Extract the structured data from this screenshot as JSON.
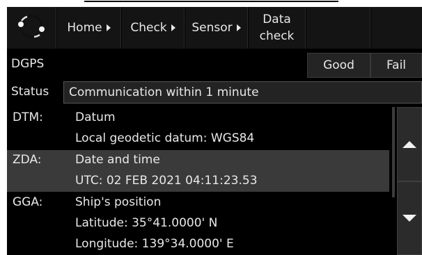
{
  "nav": {
    "home": "Home",
    "check": "Check",
    "sensor": "Sensor",
    "data_check_line1": "Data",
    "data_check_line2": "check"
  },
  "dgps": {
    "label": "DGPS",
    "good": "Good",
    "fail": "Fail"
  },
  "status": {
    "label": "Status",
    "value": "Communication within 1 minute"
  },
  "sentences": [
    {
      "code": "DTM:",
      "lines": [
        "Datum",
        "Local geodetic datum: WGS84"
      ]
    },
    {
      "code": "ZDA:",
      "lines": [
        "Date and time",
        "UTC: 02 FEB 2021 04:11:23.53"
      ]
    },
    {
      "code": "GGA:",
      "lines": [
        "Ship's position",
        "Latitude: 35°41.0000' N",
        "Longitude: 139°34.0000' E"
      ]
    }
  ],
  "icons": {
    "logo": "ring-logo-icon",
    "nav_arrow": "triangle-right-icon",
    "scroll_up": "triangle-up-icon",
    "scroll_down": "triangle-down-icon"
  },
  "colors": {
    "background": "#000000",
    "selected_row": "#3a3a3a",
    "text": "#e8e8e8"
  }
}
